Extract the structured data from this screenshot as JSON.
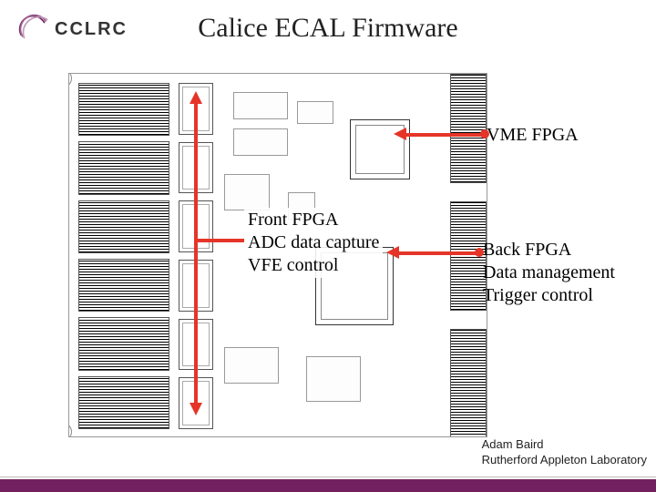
{
  "logo": {
    "text": "CCLRC"
  },
  "title": "Calice ECAL Firmware",
  "callouts": {
    "vme": {
      "line1": "VME FPGA"
    },
    "front": {
      "line1": "Front FPGA",
      "line2": "ADC data capture",
      "line3": "VFE control"
    },
    "back": {
      "line1": "Back FPGA",
      "line2": "Data management",
      "line3": "Trigger control"
    }
  },
  "annotations": {
    "vme_target": "vme-fpga-chip",
    "back_target": "back-fpga-chip",
    "front_target": "front-fpga-column"
  },
  "footer": {
    "author": "Adam Baird",
    "affiliation": "Rutherford Appleton Laboratory"
  },
  "colors": {
    "accent": "#72205f",
    "arrow": "#e53528"
  }
}
